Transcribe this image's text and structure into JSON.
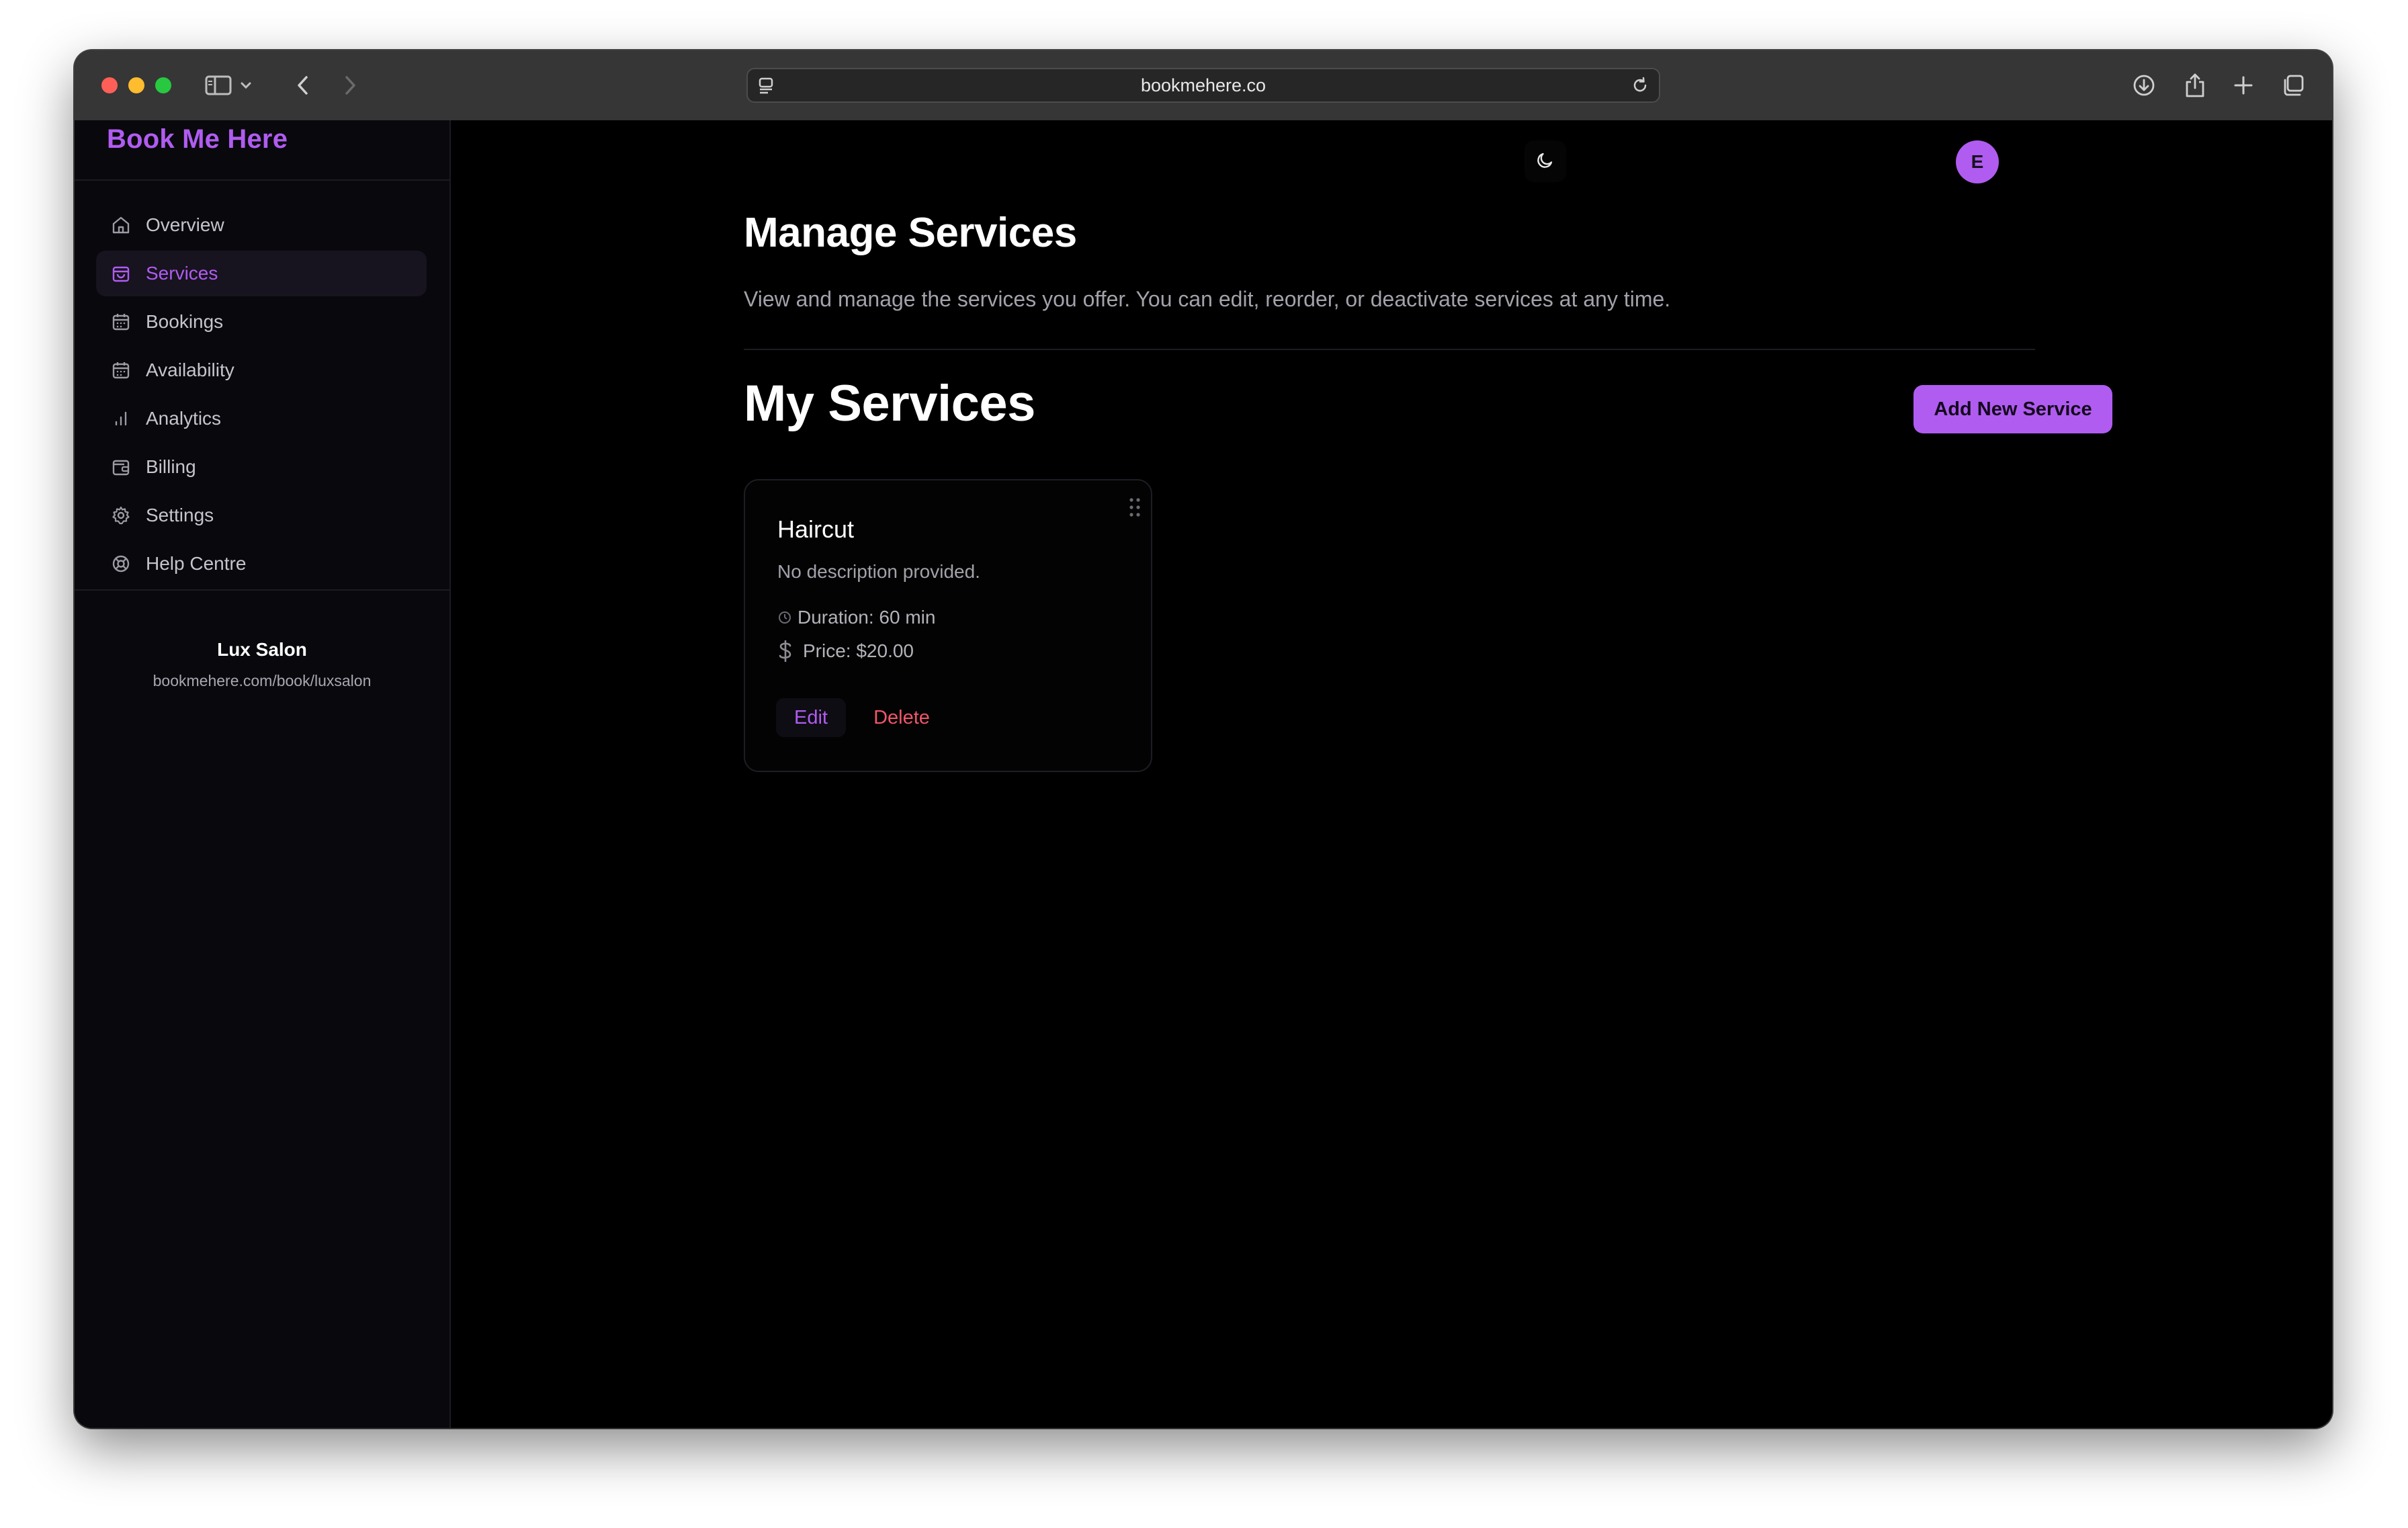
{
  "browser": {
    "url": "bookmehere.co"
  },
  "sidebar": {
    "brand": "Book Me Here",
    "items": [
      {
        "label": "Overview",
        "icon": "home-icon",
        "active": false
      },
      {
        "label": "Services",
        "icon": "shopping-bag-icon",
        "active": true
      },
      {
        "label": "Bookings",
        "icon": "calendar-icon",
        "active": false
      },
      {
        "label": "Availability",
        "icon": "calendar-icon",
        "active": false
      },
      {
        "label": "Analytics",
        "icon": "bar-chart-icon",
        "active": false
      },
      {
        "label": "Billing",
        "icon": "wallet-icon",
        "active": false
      },
      {
        "label": "Settings",
        "icon": "gear-icon",
        "active": false
      },
      {
        "label": "Help Centre",
        "icon": "lifebuoy-icon",
        "active": false
      }
    ],
    "account": {
      "name": "Lux Salon",
      "url": "bookmehere.com/book/luxsalon"
    }
  },
  "header": {
    "avatar_initial": "E"
  },
  "main": {
    "title": "Manage Services",
    "subtitle": "View and manage the services you offer. You can edit, reorder, or deactivate services at any time.",
    "section_title": "My Services",
    "add_button_label": "Add New Service",
    "services": [
      {
        "name": "Haircut",
        "description": "No description provided.",
        "duration": "Duration: 60 min",
        "price": "Price: $20.00",
        "edit_label": "Edit",
        "delete_label": "Delete"
      }
    ]
  },
  "colors": {
    "accent": "#b05cf0",
    "danger": "#f0566a",
    "background": "#000000",
    "sidebar_bg": "#09080d"
  }
}
